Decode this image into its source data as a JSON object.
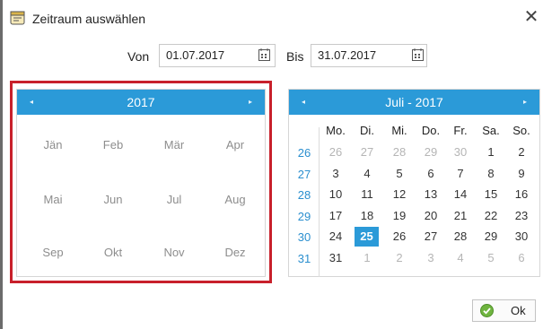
{
  "window": {
    "title": "Zeitraum auswählen",
    "close": "✕"
  },
  "range": {
    "from_label": "Von",
    "from_value": "01.07.2017",
    "to_label": "Bis",
    "to_value": "31.07.2017"
  },
  "year_view": {
    "caption": "2017",
    "prev": "◂",
    "next": "▸",
    "months": [
      "Jän",
      "Feb",
      "Mär",
      "Apr",
      "Mai",
      "Jun",
      "Jul",
      "Aug",
      "Sep",
      "Okt",
      "Nov",
      "Dez"
    ]
  },
  "month_view": {
    "caption": "Juli - 2017",
    "prev": "◂",
    "next": "▸",
    "weekdays": [
      "Mo.",
      "Di.",
      "Mi.",
      "Do.",
      "Fr.",
      "Sa.",
      "So."
    ],
    "weeks": [
      {
        "number": "26",
        "days": [
          {
            "d": "26",
            "other": true
          },
          {
            "d": "27",
            "other": true
          },
          {
            "d": "28",
            "other": true
          },
          {
            "d": "29",
            "other": true
          },
          {
            "d": "30",
            "other": true
          },
          {
            "d": "1"
          },
          {
            "d": "2"
          }
        ]
      },
      {
        "number": "27",
        "days": [
          {
            "d": "3"
          },
          {
            "d": "4"
          },
          {
            "d": "5"
          },
          {
            "d": "6"
          },
          {
            "d": "7"
          },
          {
            "d": "8"
          },
          {
            "d": "9"
          }
        ]
      },
      {
        "number": "28",
        "days": [
          {
            "d": "10"
          },
          {
            "d": "11"
          },
          {
            "d": "12"
          },
          {
            "d": "13"
          },
          {
            "d": "14"
          },
          {
            "d": "15"
          },
          {
            "d": "16"
          }
        ]
      },
      {
        "number": "29",
        "days": [
          {
            "d": "17"
          },
          {
            "d": "18"
          },
          {
            "d": "19"
          },
          {
            "d": "20"
          },
          {
            "d": "21"
          },
          {
            "d": "22"
          },
          {
            "d": "23"
          }
        ]
      },
      {
        "number": "30",
        "days": [
          {
            "d": "24"
          },
          {
            "d": "25",
            "selected": true
          },
          {
            "d": "26"
          },
          {
            "d": "27"
          },
          {
            "d": "28"
          },
          {
            "d": "29"
          },
          {
            "d": "30"
          }
        ]
      },
      {
        "number": "31",
        "days": [
          {
            "d": "31"
          },
          {
            "d": "1",
            "other": true
          },
          {
            "d": "2",
            "other": true
          },
          {
            "d": "3",
            "other": true
          },
          {
            "d": "4",
            "other": true
          },
          {
            "d": "5",
            "other": true
          },
          {
            "d": "6",
            "other": true
          }
        ]
      }
    ]
  },
  "ok_button": {
    "label": "Ok"
  },
  "colors": {
    "accent": "#2b9ad8",
    "highlight_border": "#c8202b",
    "week_number": "#2b8fcf"
  }
}
